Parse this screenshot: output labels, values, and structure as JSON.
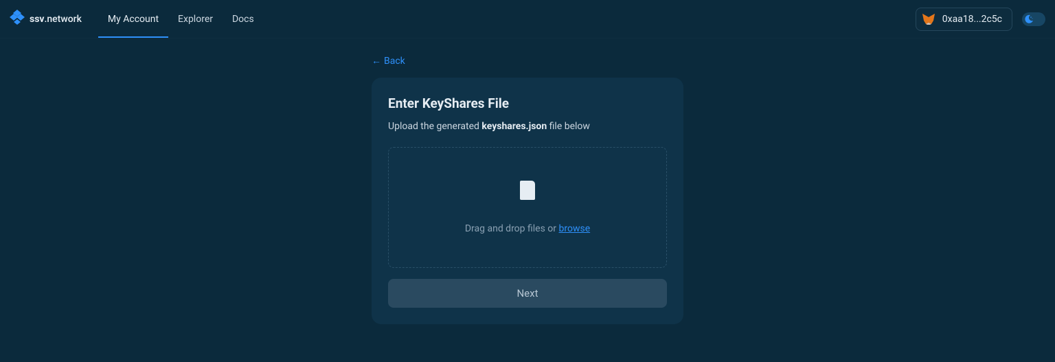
{
  "brand": {
    "bold": "ssv",
    "rest": ".network"
  },
  "nav": {
    "my_account": "My Account",
    "explorer": "Explorer",
    "docs": "Docs"
  },
  "account": {
    "address": "0xaa18...2c5c"
  },
  "page": {
    "back": "Back",
    "card_title": "Enter KeyShares File",
    "upload_pre": "Upload the generated ",
    "upload_bold": "keyshares.json",
    "upload_post": " file below",
    "dz_pre": "Drag and drop files or ",
    "dz_link": "browse",
    "next": "Next"
  }
}
